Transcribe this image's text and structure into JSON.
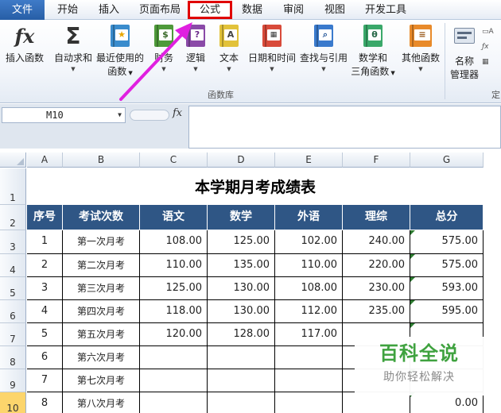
{
  "menu": {
    "tabs": [
      "文件",
      "开始",
      "插入",
      "页面布局",
      "公式",
      "数据",
      "审阅",
      "视图",
      "开发工具"
    ],
    "highlighted": "公式"
  },
  "ribbon": {
    "insert_function": "插入函数",
    "autosum": "自动求和",
    "recent_line1": "最近使用的",
    "recent_line2": "函数",
    "finance": "财务",
    "logic": "逻辑",
    "text": "文本",
    "datetime": "日期和时间",
    "lookup": "查找与引用",
    "math_line1": "数学和",
    "math_line2": "三角函数",
    "other": "其他函数",
    "name_line1": "名称",
    "name_line2": "管理器",
    "group_label": "函数库",
    "group_label2": "定",
    "fx_symbol": "fx",
    "sigma": "Σ",
    "text_icon": "A",
    "math_icon": "θ"
  },
  "formula_bar": {
    "name_box": "M10",
    "fx_label": "fx",
    "content": ""
  },
  "grid": {
    "columns": [
      "A",
      "B",
      "C",
      "D",
      "E",
      "F",
      "G"
    ],
    "rows": [
      "1",
      "2",
      "3",
      "4",
      "5",
      "6",
      "7",
      "8",
      "9",
      "10"
    ],
    "selected_row": "10"
  },
  "sheet": {
    "title": "本学期月考成绩表",
    "headers": [
      "序号",
      "考试次数",
      "语文",
      "数学",
      "外语",
      "理综",
      "总分"
    ],
    "rows": [
      [
        "1",
        "第一次月考",
        "108.00",
        "125.00",
        "102.00",
        "240.00",
        "575.00"
      ],
      [
        "2",
        "第二次月考",
        "110.00",
        "135.00",
        "110.00",
        "220.00",
        "575.00"
      ],
      [
        "3",
        "第三次月考",
        "125.00",
        "130.00",
        "108.00",
        "230.00",
        "593.00"
      ],
      [
        "4",
        "第四次月考",
        "118.00",
        "130.00",
        "112.00",
        "235.00",
        "595.00"
      ],
      [
        "5",
        "第五次月考",
        "120.00",
        "128.00",
        "117.00",
        "",
        ""
      ],
      [
        "6",
        "第六次月考",
        "",
        "",
        "",
        "",
        ""
      ],
      [
        "7",
        "第七次月考",
        "",
        "",
        "",
        "",
        ""
      ],
      [
        "8",
        "第八次月考",
        "",
        "",
        "",
        "",
        "0.00"
      ]
    ]
  },
  "watermark": {
    "big": "百科全说",
    "small": "助你轻松解决"
  },
  "colors": {
    "header_fill": "#2f5685",
    "highlight_box": "#e00000",
    "arrow": "#e020e0",
    "selected_row": "#fcd56c"
  }
}
